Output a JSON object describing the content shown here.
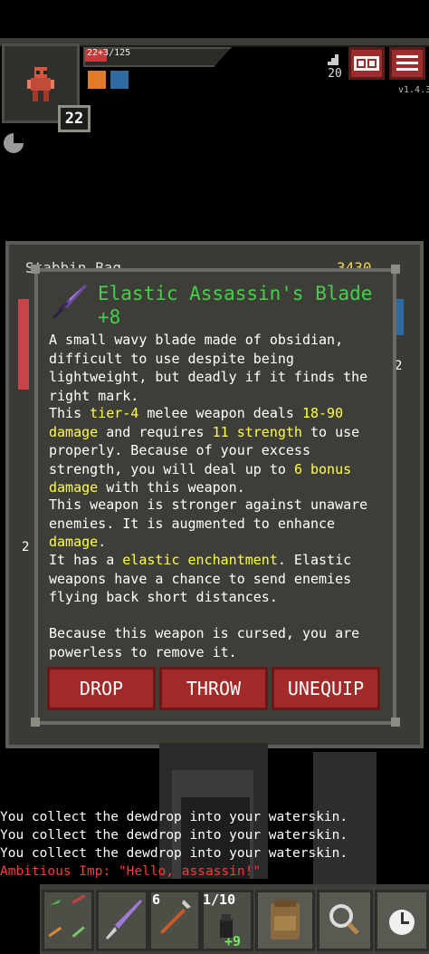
{
  "status": {
    "hp_text": "22+3/125",
    "hp_fraction": 0.18,
    "hero_level": "22",
    "depth": "20",
    "version": "v1.4.3"
  },
  "inventory_bg": {
    "title": "Stabbin Bag",
    "gold": "3430",
    "side_count_right": "2",
    "side_count_left": "2"
  },
  "item": {
    "name": "Elastic Assassin's Blade",
    "upgrade": "+8",
    "icon": "obsidian-blade-icon",
    "desc1": "A small wavy blade made of obsidian, difficult to use despite being lightweight, but deadly if it finds the right mark.",
    "desc2_parts": [
      "This ",
      "tier-4",
      " melee weapon deals ",
      "18-90 damage",
      " and requires ",
      "11 strength",
      " to use properly. Because of your excess strength, you will deal up to ",
      "6 bonus damage",
      " with this weapon."
    ],
    "desc3_parts": [
      "This weapon is stronger against unaware enemies. It is augmented to enhance ",
      "damage",
      "."
    ],
    "desc4_parts": [
      "It has a ",
      "elastic enchantment",
      ". Elastic weapons have a chance to send enemies flying back short distances."
    ],
    "desc5": "Because this weapon is cursed, you are powerless to remove it."
  },
  "buttons": {
    "drop": "DROP",
    "throw": "THROW",
    "unequip": "UNEQUIP"
  },
  "log": [
    {
      "text": "You collect the dewdrop into your waterskin.",
      "color": "#ffffff"
    },
    {
      "text": "You collect the dewdrop into your waterskin.",
      "color": "#ffffff"
    },
    {
      "text": "You collect the dewdrop into your waterskin.",
      "color": "#ffffff"
    },
    {
      "text": "Ambitious Imp: \"Hello, assassin!\"",
      "color": "#ff3a3a"
    }
  ],
  "quickslots": {
    "slot2_count": "6",
    "slot3_count": "1/10",
    "slot3_bonus": "+9"
  },
  "colors": {
    "title_green": "#44d04a",
    "highlight_yellow": "#ffff44",
    "button_red": "#a22a29",
    "log_red": "#ff3a3a"
  }
}
